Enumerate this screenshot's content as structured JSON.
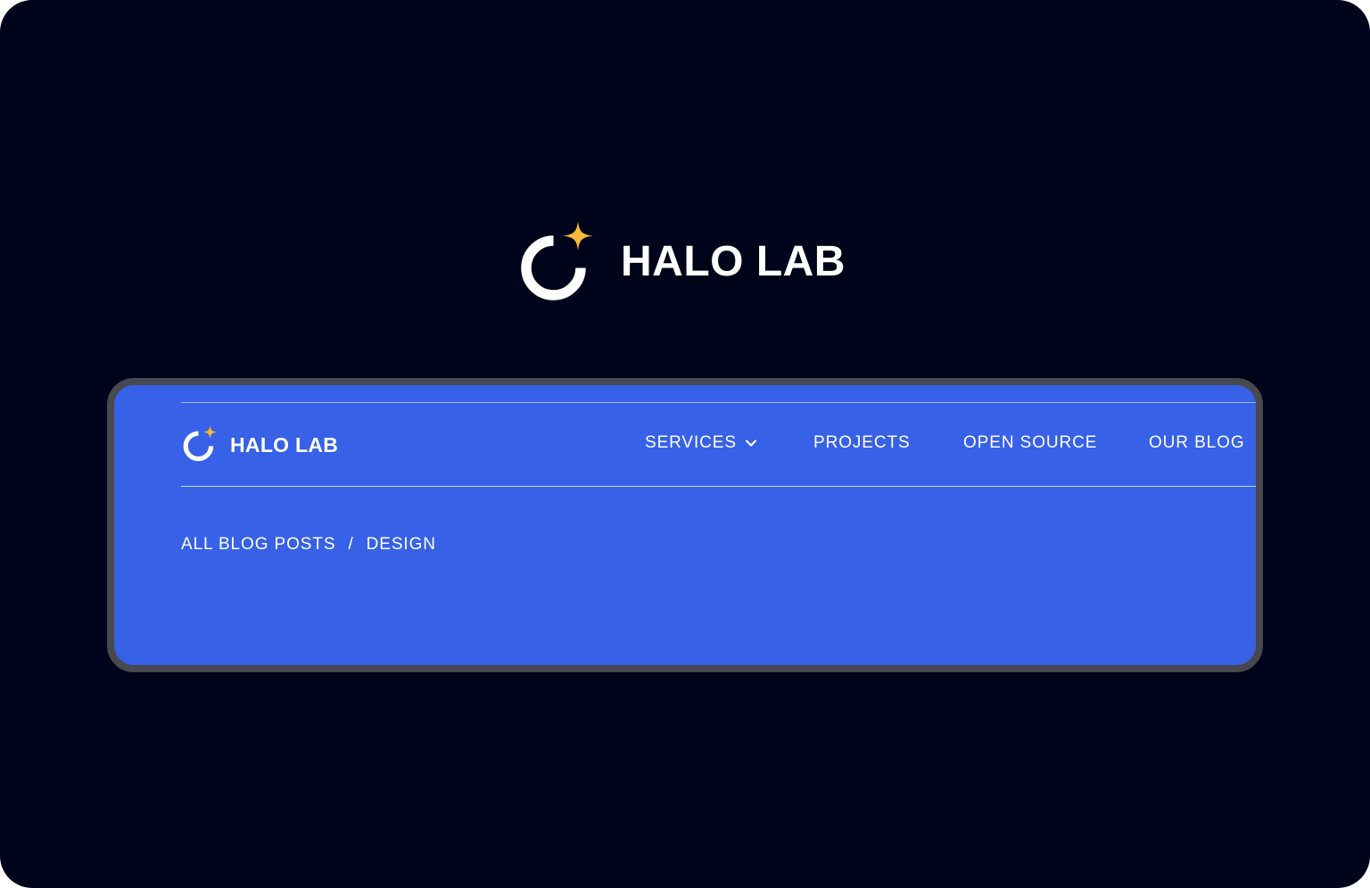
{
  "brand": {
    "name": "HALO LAB",
    "colors": {
      "background": "#00041b",
      "frame_bg": "#3761e6",
      "frame_border": "#47494f",
      "accent_star": "#f7b93a",
      "text": "#ffffff"
    }
  },
  "hero": {
    "logo_icon": "halo-ring-with-star-icon",
    "wordmark": "HALO LAB"
  },
  "site_header": {
    "logo_icon": "halo-ring-with-star-icon",
    "wordmark": "HALO LAB",
    "nav": {
      "services": "SERVICES",
      "services_icon": "chevron-down-icon",
      "projects": "PROJECTS",
      "open_source": "OPEN SOURCE",
      "our_blog": "OUR BLOG"
    }
  },
  "breadcrumb": {
    "root": "ALL BLOG POSTS",
    "separator": "/",
    "current": "DESIGN"
  }
}
